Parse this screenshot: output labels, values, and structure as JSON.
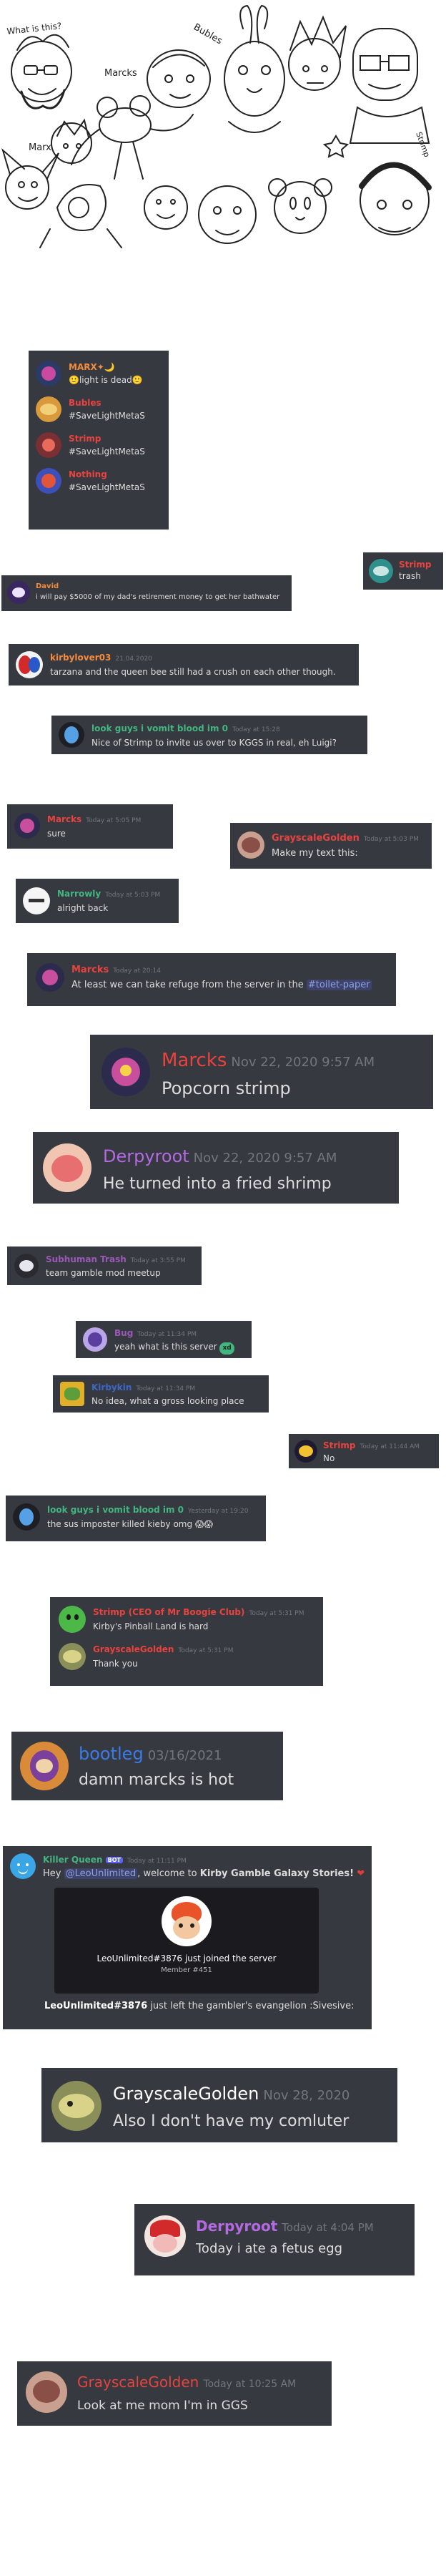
{
  "sketch": {
    "title_note": "What is this?",
    "tag_marx": "Marx",
    "tag_bubles": "Bubles",
    "tag_marcks": "Marcks",
    "tag_strimp": "Strimp"
  },
  "members": [
    {
      "name": "MARX✦🌙",
      "status": "🙂light is dead🙂",
      "color": "#f58b3c"
    },
    {
      "name": "Bubles",
      "status": "#SaveLightMetaS",
      "color": "#e8433f"
    },
    {
      "name": "Strimp",
      "status": "#SaveLightMetaS",
      "color": "#e8433f"
    },
    {
      "name": "Nothing",
      "status": "#SaveLightMetaS",
      "color": "#e8433f"
    }
  ],
  "messages": {
    "strimp_trash": {
      "name": "Strimp",
      "text": "trash"
    },
    "david": {
      "name": "David",
      "text": "i will pay $5000 of my dad's retirement money to get her bathwater"
    },
    "kirbylover": {
      "name": "kirbylover03",
      "time": "21.04.2020",
      "text": "tarzana and the queen bee still had a crush on each other though."
    },
    "lookguys1": {
      "name": "look guys i vomit blood im 0",
      "time": "Today at 15:28",
      "text": "Nice of Strimp to invite us over to KGGS in real, eh Luigi?"
    },
    "marcks_sure": {
      "name": "Marcks",
      "time": "Today at 5:05 PM",
      "text": "sure"
    },
    "gg_make": {
      "name": "GrayscaleGolden",
      "time": "Today at 5:03 PM",
      "text": "Make my text this:"
    },
    "narrowly": {
      "name": "Narrowly",
      "time": "Today at 5:03 PM",
      "text": "alright back"
    },
    "marcks_refuge": {
      "name": "Marcks",
      "time": "Today at 20:14",
      "text": "At least we can take refuge from the server in the ",
      "channel": "#toilet-paper"
    },
    "marcks_popcorn": {
      "name": "Marcks",
      "time": "Nov 22, 2020 9:57 AM",
      "text": "Popcorn strimp"
    },
    "derpy_fried": {
      "name": "Derpyroot",
      "time": "Nov 22, 2020 9:57 AM",
      "text": "He turned into a fried shrimp"
    },
    "subhuman": {
      "name": "Subhuman Trash",
      "time": "Today at 3:55 PM",
      "text": "team gamble mod meetup"
    },
    "bug": {
      "name": "Bug",
      "time": "Today at 11:34 PM",
      "text": "yeah what is this server",
      "badge": "xd"
    },
    "kirbykin": {
      "name": "Kirbykin",
      "time": "Today at 11:34 PM",
      "text": "No idea, what a gross looking place"
    },
    "strimp_no": {
      "name": "Strimp",
      "time": "Today at 11:44 AM",
      "text": "No"
    },
    "lookguys2": {
      "name": "look guys i vomit blood im 0",
      "time": "Yesterday at 19:20",
      "text": "the sus imposter killed kieby omg",
      "emoji": "😱😱"
    },
    "strimp_pinball": {
      "name": "Strimp (CEO of Mr Boogie Club)",
      "time": "Today at 5:31 PM",
      "text": "Kirby's Pinball Land is hard"
    },
    "gg_thank": {
      "name": "GrayscaleGolden",
      "time": "Today at 5:31 PM",
      "text": "Thank you"
    },
    "bootleg": {
      "name": "bootleg",
      "time": "03/16/2021",
      "text": "damn marcks is hot"
    },
    "gg_comluter": {
      "name": "GrayscaleGolden",
      "time": "Nov 28, 2020",
      "text": "Also I don't have my comluter"
    },
    "derpy_egg": {
      "name": "Derpyroot",
      "time": "Today at 4:04 PM",
      "text": "Today i ate a fetus egg"
    },
    "gg_mom": {
      "name": "GrayscaleGolden",
      "time": "Today at 10:25 AM",
      "text": "Look at me mom I'm in GGS"
    }
  },
  "welcome": {
    "bot_name": "Killer Queen",
    "bot_tag": "BOT",
    "time": "Today at 11:11 PM",
    "hey": "Hey",
    "mention": "@LeoUnlimited",
    "welcome_text": ", welcome to",
    "server": "Kirby Gamble Galaxy Stories!",
    "card_line": "LeoUnlimited#3876 just joined the server",
    "card_member": "Member #451",
    "left_user": "LeoUnlimited#3876",
    "left_text": "just left the gambler's evangelion :Sivesive:"
  }
}
